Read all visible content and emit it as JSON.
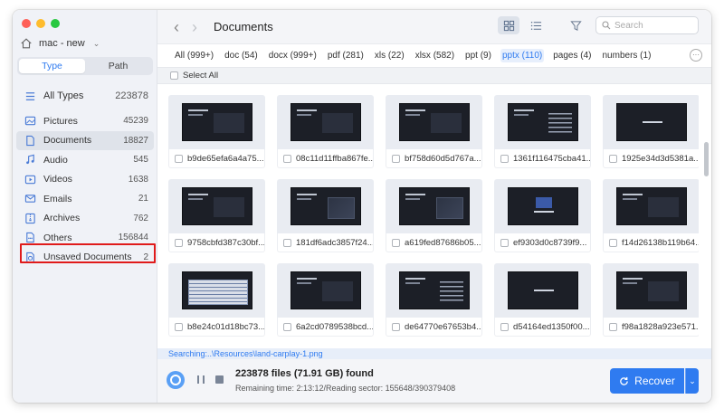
{
  "window": {
    "title": "Documents"
  },
  "sidebar": {
    "device": "mac - new",
    "tabs": [
      "Type",
      "Path"
    ],
    "active_tab": "Type",
    "all": {
      "label": "All Types",
      "count": "223878"
    },
    "items": [
      {
        "label": "Pictures",
        "count": "45239",
        "icon": "picture-icon"
      },
      {
        "label": "Documents",
        "count": "18827",
        "icon": "document-icon"
      },
      {
        "label": "Audio",
        "count": "545",
        "icon": "audio-icon"
      },
      {
        "label": "Videos",
        "count": "1638",
        "icon": "video-icon"
      },
      {
        "label": "Emails",
        "count": "21",
        "icon": "email-icon"
      },
      {
        "label": "Archives",
        "count": "762",
        "icon": "archive-icon"
      },
      {
        "label": "Others",
        "count": "156844",
        "icon": "others-icon"
      },
      {
        "label": "Unsaved Documents",
        "count": "2",
        "icon": "unsaved-doc-icon"
      }
    ]
  },
  "toolbar": {
    "search_placeholder": "Search"
  },
  "filters": [
    "All (999+)",
    "doc (54)",
    "docx (999+)",
    "pdf (281)",
    "xls (22)",
    "xlsx (582)",
    "ppt (9)",
    "pptx (110)",
    "pages (4)",
    "numbers (1)"
  ],
  "active_filter": "pptx (110)",
  "select_all": "Select All",
  "files": [
    {
      "name": "b9de65efa6a4a75...",
      "style": "title-block"
    },
    {
      "name": "08c11d11ffba867fe...",
      "style": "title-block"
    },
    {
      "name": "bf758d60d5d767a...",
      "style": "title-block"
    },
    {
      "name": "1361f116475cba41...",
      "style": "list"
    },
    {
      "name": "1925e34d3d5381a...",
      "style": "center"
    },
    {
      "name": "9758cbfd387c30bf...",
      "style": "title-block"
    },
    {
      "name": "181df6adc3857f24...",
      "style": "vector"
    },
    {
      "name": "a619fed87686b05...",
      "style": "vector"
    },
    {
      "name": "ef9303d0c8739f9...",
      "style": "box"
    },
    {
      "name": "f14d26138b119b64...",
      "style": "title-block"
    },
    {
      "name": "b8e24c01d18bc73...",
      "style": "table"
    },
    {
      "name": "6a2cd0789538bcd...",
      "style": "title-block"
    },
    {
      "name": "de64770e67653b4...",
      "style": "list"
    },
    {
      "name": "d54164ed1350f00...",
      "style": "center"
    },
    {
      "name": "f98a1828a923e571...",
      "style": "title-block"
    }
  ],
  "status": {
    "searching": "Searching:..\\Resources\\land-carplay-1.png",
    "found": "223878 files (71.91 GB) found",
    "remaining": "Remaining time: 2:13:12/Reading sector: 155648/390379408",
    "recover_label": "Recover"
  },
  "colors": {
    "accent": "#2f7bf0",
    "highlight": "#e01b1b",
    "sidebar_bg": "#f0f2f7"
  }
}
